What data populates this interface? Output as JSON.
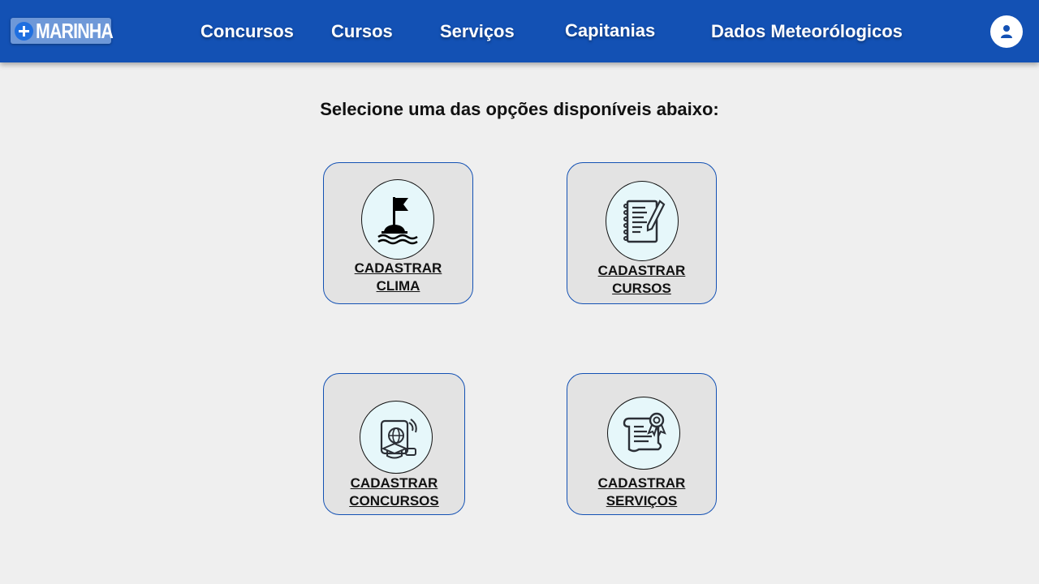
{
  "brand": {
    "logo_text": "MARINHA"
  },
  "nav": {
    "items": [
      {
        "label": "Concursos"
      },
      {
        "label": "Cursos"
      },
      {
        "label": "Serviços"
      },
      {
        "label": "Capitanias"
      },
      {
        "label": "Dados Meteorólogicos"
      }
    ]
  },
  "main": {
    "heading": "Selecione uma das opções disponíveis abaixo:",
    "cards": [
      {
        "line1": "CADASTRAR",
        "line2": "CLIMA",
        "icon": "buoy-flag-icon"
      },
      {
        "line1": "CADASTRAR",
        "line2": "CURSOS",
        "icon": "notebook-pencil-icon"
      },
      {
        "line1": "CADASTRAR",
        "line2": "CONCURSOS",
        "icon": "online-education-icon"
      },
      {
        "line1": "CADASTRAR",
        "line2": "SERVIÇOS",
        "icon": "certificate-icon"
      }
    ]
  },
  "colors": {
    "primary": "#1351b4",
    "background": "#efefef",
    "card": "#e3e3e3",
    "icon_circle": "#e6f7fa"
  }
}
